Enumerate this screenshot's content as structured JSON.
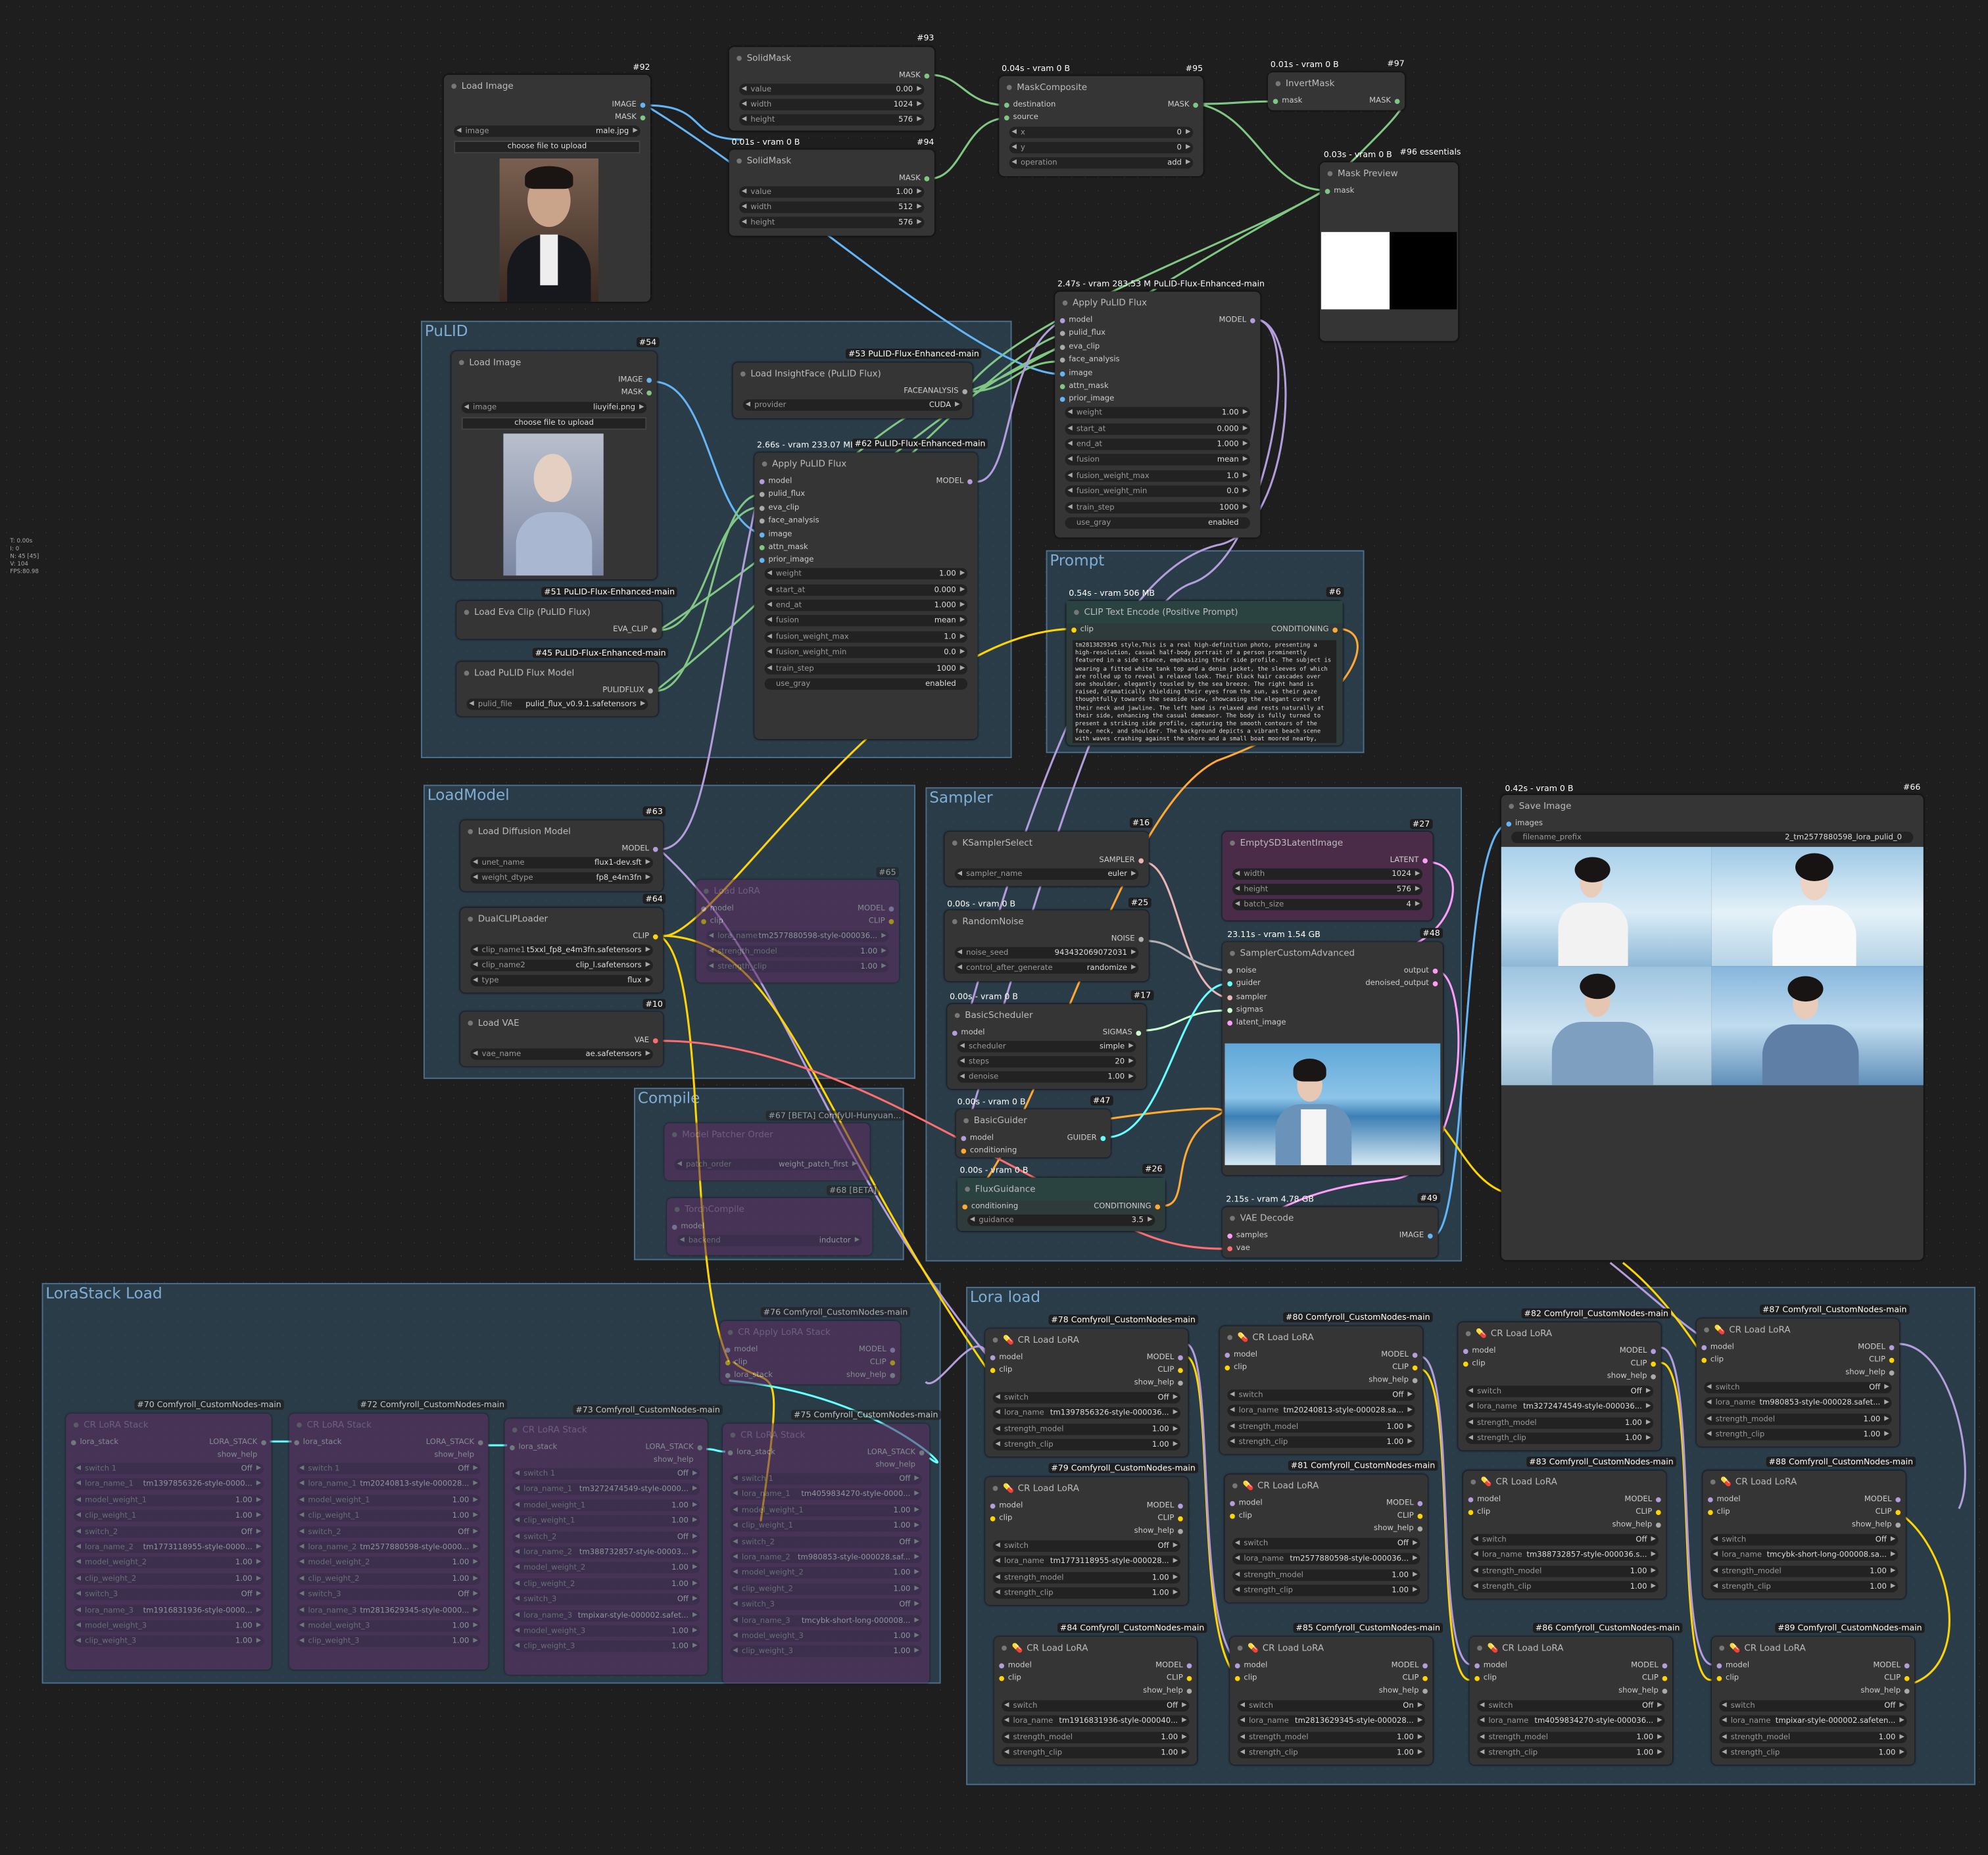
{
  "info": {
    "lines": [
      "T: 0.00s",
      "I: 0",
      "N: 45 [45]",
      "V: 104",
      "FPS:80.98"
    ]
  },
  "groups": {
    "pulid": "PuLID",
    "prompt": "Prompt",
    "loadmodel": "LoadModel",
    "sampler": "Sampler",
    "compile": "Compile",
    "lorastack": "LoraStack Load",
    "loraload": "Lora load"
  },
  "nodes": {
    "n92": {
      "id": "#92",
      "title": "Load Image",
      "out1": "IMAGE",
      "out2": "MASK",
      "image_label": "image",
      "image_value": "male.jpg",
      "upload": "choose file to upload"
    },
    "n93": {
      "id": "#93",
      "title": "SolidMask",
      "out": "MASK",
      "value": "0.00",
      "width": "1024",
      "height": "576"
    },
    "n94": {
      "id": "#94",
      "stats": "0.01s - vram 0 B",
      "title": "SolidMask",
      "out": "MASK",
      "value": "1.00",
      "width": "512",
      "height": "576"
    },
    "n95": {
      "id": "#95",
      "stats": "0.04s - vram 0 B",
      "title": "MaskComposite",
      "in1": "destination",
      "in2": "source",
      "out": "MASK",
      "x": "0",
      "y": "0",
      "operation": "add"
    },
    "n97": {
      "id": "#97",
      "stats": "0.01s - vram 0 B",
      "title": "InvertMask",
      "in": "mask",
      "out": "MASK"
    },
    "n96": {
      "id": "#96 essentials",
      "stats": "0.03s - vram 0 B",
      "title": "Mask Preview",
      "in": "mask"
    },
    "n53b": {
      "id": "PuLID-Flux-Enhanced-main",
      "stats": "2.47s - vram 283.53 MB",
      "title": "Apply PuLID Flux",
      "out": "MODEL",
      "inputs": [
        "model",
        "pulid_flux",
        "eva_clip",
        "face_analysis",
        "image",
        "attn_mask",
        "prior_image"
      ],
      "weight": "1.00",
      "start_at": "0.000",
      "end_at": "1.000",
      "fusion": "mean",
      "fusion_weight_max": "1.0",
      "fusion_weight_min": "0.0",
      "train_step": "1000",
      "use_gray": "enabled"
    },
    "n54": {
      "id": "#54",
      "title": "Load Image",
      "out1": "IMAGE",
      "out2": "MASK",
      "image_label": "image",
      "image_value": "liuyifei.png",
      "upload": "choose file to upload"
    },
    "n53": {
      "id": "#53 PuLID-Flux-Enhanced-main",
      "title": "Load InsightFace (PuLID Flux)",
      "out": "FACEANALYSIS",
      "provider": "CUDA"
    },
    "n62": {
      "id": "#62 PuLID-Flux-Enhanced-main",
      "stats": "2.66s - vram 233.07 MB",
      "title": "Apply PuLID Flux",
      "out": "MODEL",
      "inputs": [
        "model",
        "pulid_flux",
        "eva_clip",
        "face_analysis",
        "image",
        "attn_mask",
        "prior_image"
      ],
      "weight": "1.00",
      "start_at": "0.000",
      "end_at": "1.000",
      "fusion": "mean",
      "fusion_weight_max": "1.0",
      "fusion_weight_min": "0.0",
      "train_step": "1000",
      "use_gray": "enabled"
    },
    "n51": {
      "id": "#51 PuLID-Flux-Enhanced-main",
      "title": "Load Eva Clip (PuLID Flux)",
      "out": "EVA_CLIP"
    },
    "n45": {
      "id": "#45 PuLID-Flux-Enhanced-main",
      "title": "Load PuLID Flux Model",
      "out": "PULIDFLUX",
      "pulid_file": "pulid_flux_v0.9.1.safetensors"
    },
    "n6": {
      "id": "#6",
      "stats": "0.54s - vram 506 MB",
      "title": "CLIP Text Encode (Positive Prompt)",
      "in": "clip",
      "out": "CONDITIONING",
      "text": "tm2813829345 style,This is a real high-definition photo, presenting a high-resolution, casual half-body portrait of a person prominently featured in a side stance, emphasizing their side profile. The subject is wearing a fitted white tank top and a denim jacket, the sleeves of which are rolled up to reveal a relaxed look. Their black hair cascades over one shoulder, elegantly tousled by the sea breeze. The right hand is raised, dramatically shielding their eyes from the sun, as their gaze thoughtfully towards the seaside view, showcasing the elegant curve of their neck and jawline. The left hand is relaxed and rests naturally at their side, enhancing the casual demeanor. The body is fully turned to present a striking side profile, capturing the smooth contours of the face, neck, and shoulder. The background depicts a vibrant beach scene with waves crashing against the shore and a small boat moored nearby, further enhancing the tranquil seaside atmosphere."
    },
    "n63": {
      "id": "#63",
      "title": "Load Diffusion Model",
      "out": "MODEL",
      "unet_name": "flux1-dev.sft",
      "weight_dtype": "fp8_e4m3fn"
    },
    "n64": {
      "id": "#64",
      "title": "DualCLIPLoader",
      "out": "CLIP",
      "clip_name1": "t5xxl_fp8_e4m3fn.safetensors",
      "clip_name2": "clip_l.safetensors",
      "type": "flux"
    },
    "n10": {
      "id": "#10",
      "title": "Load VAE",
      "out": "VAE",
      "vae_name": "ae.safetensors"
    },
    "n65": {
      "id": "#65",
      "title": "Load LoRA",
      "lora_name": "tm2577880598-style-000036...",
      "strength_model": "1.00",
      "strength_clip": "1.00"
    },
    "n16": {
      "id": "#16",
      "title": "KSamplerSelect",
      "out": "SAMPLER",
      "sampler_name": "euler"
    },
    "n25": {
      "id": "#25",
      "stats": "0.00s - vram 0 B",
      "title": "RandomNoise",
      "out": "NOISE",
      "noise_seed": "943432069072031",
      "control_after_generate": "randomize"
    },
    "n17": {
      "id": "#17",
      "stats": "0.00s - vram 0 B",
      "title": "BasicScheduler",
      "in": "model",
      "out": "SIGMAS",
      "scheduler": "simple",
      "steps": "20",
      "denoise": "1.00"
    },
    "n47": {
      "id": "#47",
      "stats": "0.00s - vram 0 B",
      "title": "BasicGuider",
      "in1": "model",
      "in2": "conditioning",
      "out": "GUIDER"
    },
    "n26": {
      "id": "#26",
      "stats": "0.00s - vram 0 B",
      "title": "FluxGuidance",
      "in": "conditioning",
      "out": "CONDITIONING",
      "guidance": "3.5"
    },
    "n27": {
      "id": "#27",
      "title": "EmptySD3LatentImage",
      "out": "LATENT",
      "width": "1024",
      "height": "576",
      "batch_size": "4"
    },
    "n48": {
      "id": "#48",
      "stats": "23.11s - vram 1.54 GB",
      "title": "SamplerCustomAdvanced",
      "inputs": [
        "noise",
        "guider",
        "sampler",
        "sigmas",
        "latent_image"
      ],
      "out1": "output",
      "out2": "denoised_output"
    },
    "n49": {
      "id": "#49",
      "stats": "2.15s - vram 4.78 GB",
      "title": "VAE Decode",
      "in1": "samples",
      "in2": "vae",
      "out": "IMAGE"
    },
    "n66": {
      "id": "#66",
      "stats": "0.42s - vram 0 B",
      "title": "Save Image",
      "in": "images",
      "filename_prefix_label": "filename_prefix",
      "filename_prefix": "2_tm2577880598_lora_pulid_0"
    },
    "n67": {
      "id": "#67 [BETA] ComfyUI-Hunyuan...",
      "title": "Model Patcher Order",
      "l": "patch_order",
      "v": "weight_patch_first"
    },
    "n68": {
      "id": "#68 [BETA]",
      "title": "TorchCompile",
      "l1": "model",
      "l2": "backend",
      "v2": "inductor"
    },
    "n76": {
      "id": "#76 Comfyroll_CustomNodes-main",
      "title": "CR Apply LoRA Stack",
      "in1": "model",
      "in2": "clip",
      "in3": "lora_stack",
      "out1": "MODEL",
      "out2": "CLIP",
      "out3": "show_help"
    },
    "stacks": [
      {
        "id": "#70 Comfyroll_CustomNodes-main",
        "title": "CR LoRA Stack",
        "in": "lora_stack",
        "out": "LORA_STACK",
        "help": "show_help",
        "switch_1": "Off",
        "lora_name_1": "tm1397856326-style-0000...",
        "model_weight_1": "1.00",
        "clip_weight_1": "1.00",
        "switch_2": "Off",
        "lora_name_2": "tm1773118955-style-0000...",
        "model_weight_2": "1.00",
        "clip_weight_2": "1.00",
        "switch_3": "Off",
        "lora_name_3": "tm1916831936-style-0000...",
        "model_weight_3": "1.00",
        "clip_weight_3": "1.00"
      },
      {
        "id": "#72 Comfyroll_CustomNodes-main",
        "title": "CR LoRA Stack",
        "in": "lora_stack",
        "out": "LORA_STACK",
        "help": "show_help",
        "switch_1": "Off",
        "lora_name_1": "tm20240813-style-000028...",
        "model_weight_1": "1.00",
        "clip_weight_1": "1.00",
        "switch_2": "Off",
        "lora_name_2": "tm2577880598-style-0000...",
        "model_weight_2": "1.00",
        "clip_weight_2": "1.00",
        "switch_3": "Off",
        "lora_name_3": "tm2813629345-style-0000...",
        "model_weight_3": "1.00",
        "clip_weight_3": "1.00"
      },
      {
        "id": "#73 Comfyroll_CustomNodes-main",
        "title": "CR LoRA Stack",
        "in": "lora_stack",
        "out": "LORA_STACK",
        "help": "show_help",
        "switch_1": "Off",
        "lora_name_1": "tm3272474549-style-0000...",
        "model_weight_1": "1.00",
        "clip_weight_1": "1.00",
        "switch_2": "Off",
        "lora_name_2": "tm388732857-style-00003...",
        "model_weight_2": "1.00",
        "clip_weight_2": "1.00",
        "switch_3": "Off",
        "lora_name_3": "tmpixar-style-000002.safet...",
        "model_weight_3": "1.00",
        "clip_weight_3": "1.00"
      },
      {
        "id": "#75 Comfyroll_CustomNodes-main",
        "title": "CR LoRA Stack",
        "in": "lora_stack",
        "out": "LORA_STACK",
        "help": "show_help",
        "switch_1": "Off",
        "lora_name_1": "tm4059834270-style-0000...",
        "model_weight_1": "1.00",
        "clip_weight_1": "1.00",
        "switch_2": "Off",
        "lora_name_2": "tm980853-style-000028.saf...",
        "model_weight_2": "1.00",
        "clip_weight_2": "1.00",
        "switch_3": "Off",
        "lora_name_3": "tmcybk-short-long-000008...",
        "model_weight_3": "1.00",
        "clip_weight_3": "1.00"
      }
    ],
    "loras": [
      {
        "id": "#78 Comfyroll_CustomNodes-main",
        "title": "CR Load LoRA",
        "switch": "Off",
        "lora_name": "tm1397856326-style-000036...",
        "strength_model": "1.00",
        "strength_clip": "1.00"
      },
      {
        "id": "#80 Comfyroll_CustomNodes-main",
        "title": "CR Load LoRA",
        "switch": "Off",
        "lora_name": "tm20240813-style-000028.sa...",
        "strength_model": "1.00",
        "strength_clip": "1.00"
      },
      {
        "id": "#82 Comfyroll_CustomNodes-main",
        "title": "CR Load LoRA",
        "switch": "Off",
        "lora_name": "tm3272474549-style-000036...",
        "strength_model": "1.00",
        "strength_clip": "1.00"
      },
      {
        "id": "#87 Comfyroll_CustomNodes-main",
        "title": "CR Load LoRA",
        "switch": "Off",
        "lora_name": "tm980853-style-000028.safet...",
        "strength_model": "1.00",
        "strength_clip": "1.00"
      },
      {
        "id": "#79 Comfyroll_CustomNodes-main",
        "title": "CR Load LoRA",
        "switch": "Off",
        "lora_name": "tm1773118955-style-000028...",
        "strength_model": "1.00",
        "strength_clip": "1.00"
      },
      {
        "id": "#81 Comfyroll_CustomNodes-main",
        "title": "CR Load LoRA",
        "switch": "Off",
        "lora_name": "tm2577880598-style-000036...",
        "strength_model": "1.00",
        "strength_clip": "1.00"
      },
      {
        "id": "#83 Comfyroll_CustomNodes-main",
        "title": "CR Load LoRA",
        "switch": "Off",
        "lora_name": "tm388732857-style-000036.s...",
        "strength_model": "1.00",
        "strength_clip": "1.00"
      },
      {
        "id": "#88 Comfyroll_CustomNodes-main",
        "title": "CR Load LoRA",
        "switch": "Off",
        "lora_name": "tmcybk-short-long-000008.sa...",
        "strength_model": "1.00",
        "strength_clip": "1.00"
      },
      {
        "id": "#84 Comfyroll_CustomNodes-main",
        "title": "CR Load LoRA",
        "switch": "Off",
        "lora_name": "tm1916831936-style-000040...",
        "strength_model": "1.00",
        "strength_clip": "1.00"
      },
      {
        "id": "#85 Comfyroll_CustomNodes-main",
        "title": "CR Load LoRA",
        "switch": "On",
        "lora_name": "tm2813629345-style-000028...",
        "strength_model": "1.00",
        "strength_clip": "1.00"
      },
      {
        "id": "#86 Comfyroll_CustomNodes-main",
        "title": "CR Load LoRA",
        "switch": "Off",
        "lora_name": "tm4059834270-style-000036...",
        "strength_model": "1.00",
        "strength_clip": "1.00"
      },
      {
        "id": "#89 Comfyroll_CustomNodes-main",
        "title": "CR Load LoRA",
        "switch": "Off",
        "lora_name": "tmpixar-style-000002.safeten...",
        "strength_model": "1.00",
        "strength_clip": "1.00"
      }
    ],
    "lora_labels": {
      "model": "model",
      "clip": "clip",
      "MODEL": "MODEL",
      "CLIP": "CLIP",
      "show_help": "show_help",
      "switch": "switch",
      "lora_name": "lora_name",
      "strength_model": "strength_model",
      "strength_clip": "strength_clip"
    }
  },
  "colors": {
    "model": "#b39ddb",
    "clip": "#ffd500",
    "vae": "#ff6e6e",
    "image": "#64b5f6",
    "mask": "#81c784",
    "cond": "#ffa931",
    "latent": "#ff9cf9",
    "guider": "#66ffff",
    "sigmas": "#cdffcd"
  }
}
